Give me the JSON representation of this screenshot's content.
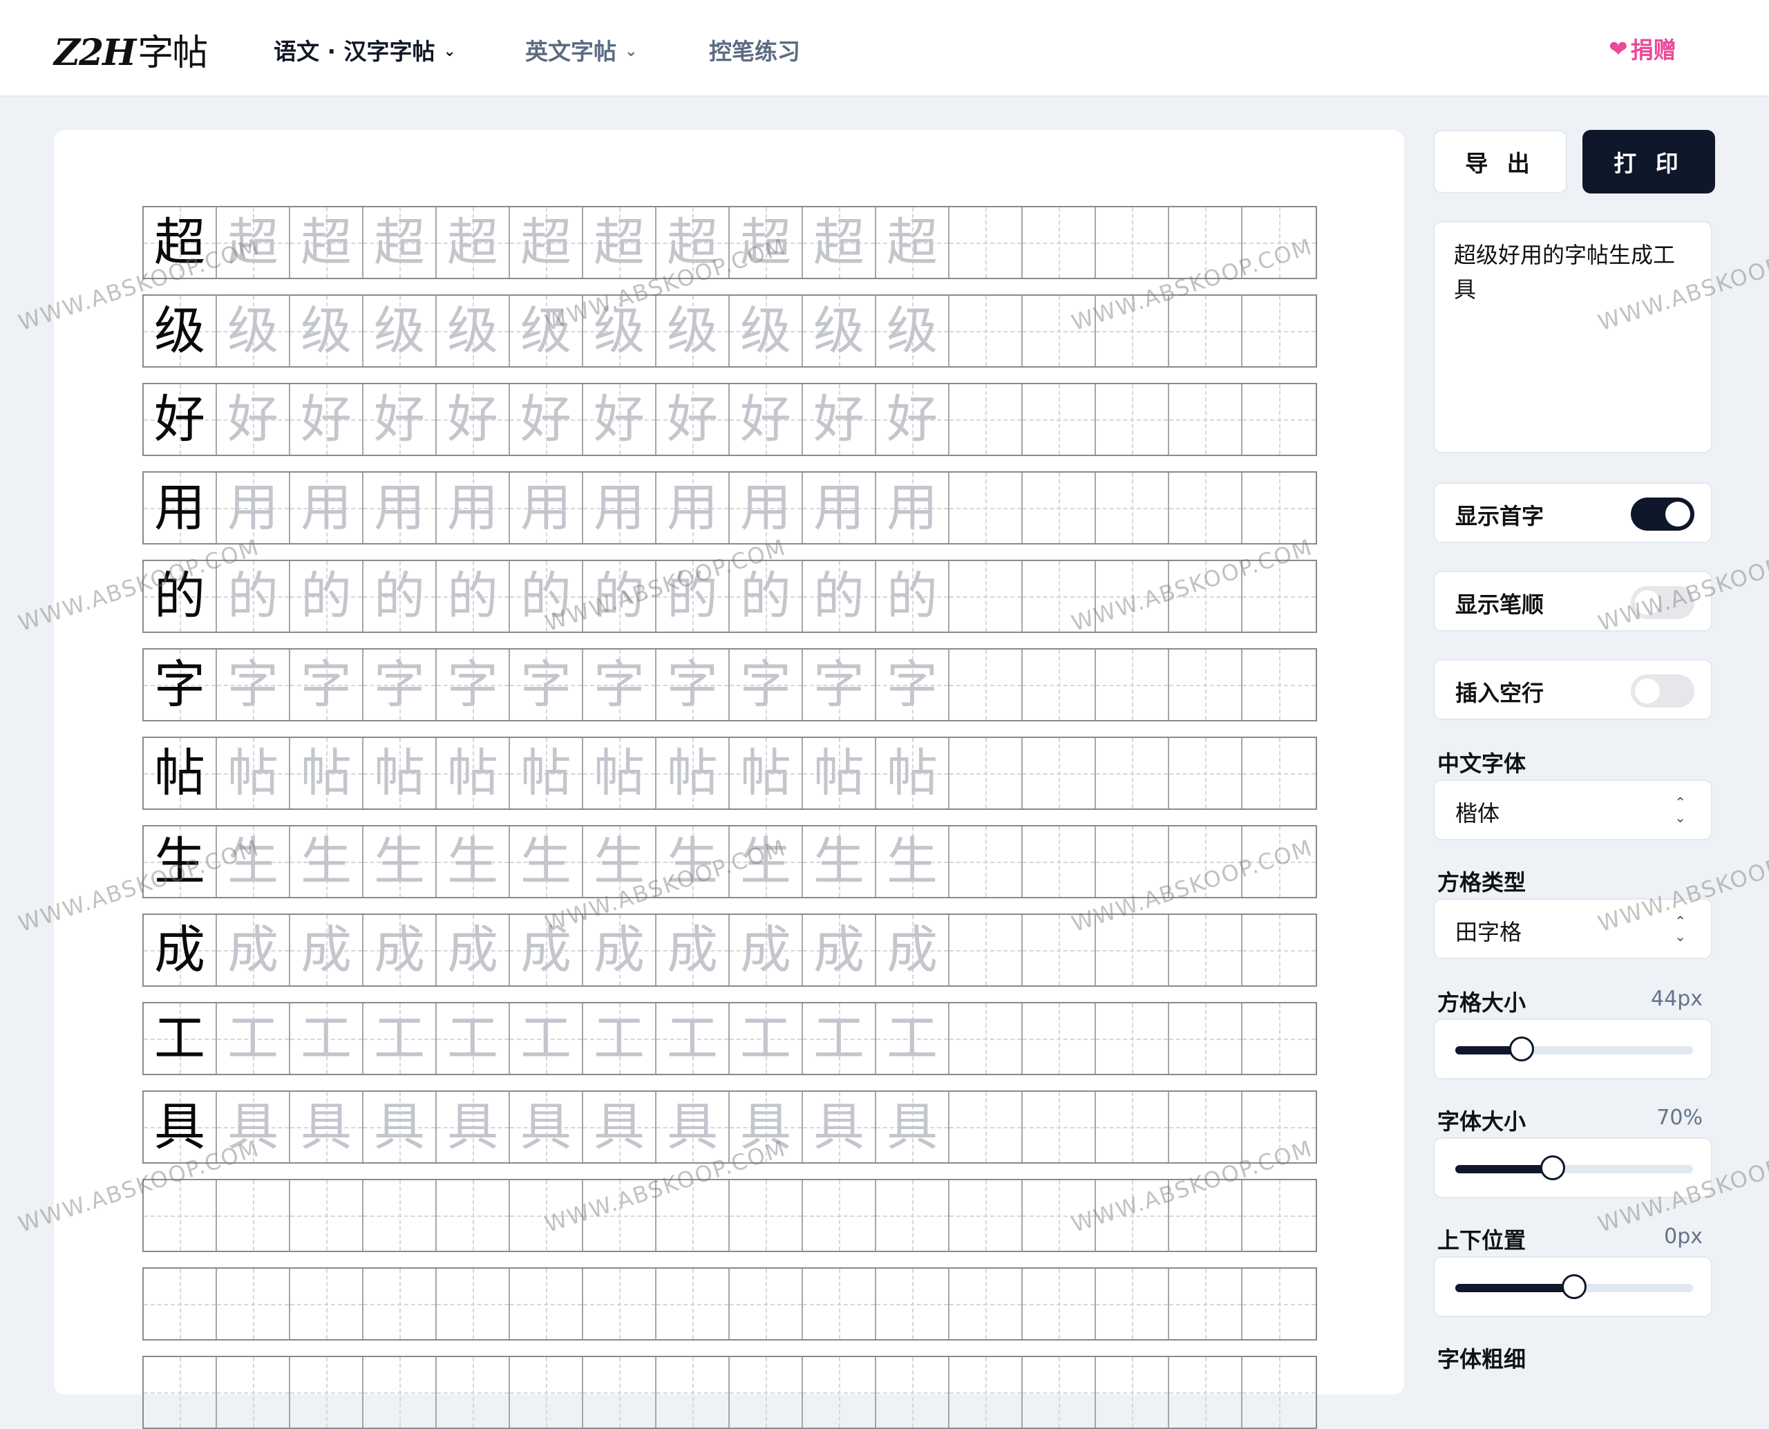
{
  "header": {
    "logo_text": "Z2H",
    "logo_cn": "字帖",
    "nav": [
      {
        "label": "语文 · 汉字字帖",
        "has_dropdown": true,
        "active": true
      },
      {
        "label": "英文字帖",
        "has_dropdown": true,
        "active": false
      },
      {
        "label": "控笔练习",
        "has_dropdown": false,
        "active": false
      }
    ],
    "donate_icon": "heart-gift-icon",
    "donate_label": "捐赠"
  },
  "toolbar": {
    "export_label": "导 出",
    "print_label": "打 印"
  },
  "input": {
    "text": "超级好用的字帖生成工具"
  },
  "toggles": [
    {
      "label": "显示首字",
      "on": true
    },
    {
      "label": "显示笔顺",
      "on": false
    },
    {
      "label": "插入空行",
      "on": false
    }
  ],
  "font_select": {
    "label": "中文字体",
    "value": "楷体"
  },
  "grid_select": {
    "label": "方格类型",
    "value": "田字格"
  },
  "sliders": [
    {
      "label": "方格大小",
      "value": "44px",
      "level": 0.28
    },
    {
      "label": "字体大小",
      "value": "70%",
      "level": 0.41
    },
    {
      "label": "上下位置",
      "value": "0px",
      "level": 0.5
    }
  ],
  "weight_label": "字体粗细",
  "worksheet": {
    "chars": [
      "超",
      "级",
      "好",
      "用",
      "的",
      "字",
      "帖",
      "生",
      "成",
      "工",
      "具"
    ],
    "columns": 16,
    "trace_copies": 10,
    "empty_rows": 3
  },
  "watermark": "WWW.ABSKOOP.COM",
  "colors": {
    "primary": "#0f172a",
    "donate": "#ec4899",
    "trace": "#c3c6cc",
    "background": "#eef2f6"
  }
}
